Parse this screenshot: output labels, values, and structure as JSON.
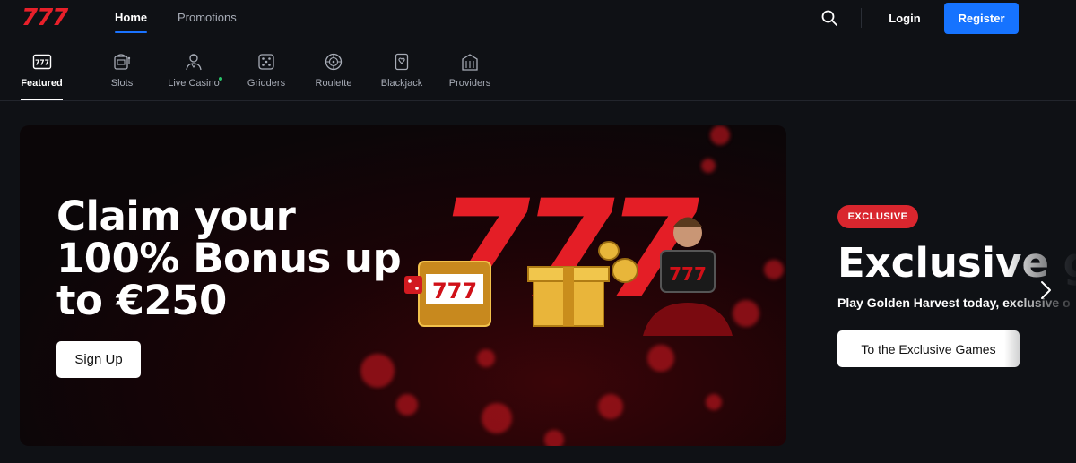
{
  "header": {
    "logo": "777",
    "nav": [
      {
        "label": "Home"
      },
      {
        "label": "Promotions"
      }
    ],
    "login_label": "Login",
    "register_label": "Register"
  },
  "categories": [
    {
      "label": "Featured",
      "icon": "777-badge-icon",
      "active": true
    },
    {
      "label": "Slots",
      "icon": "slot-machine-icon"
    },
    {
      "label": "Live Casino",
      "icon": "dealer-icon"
    },
    {
      "label": "Gridders",
      "icon": "dice-grid-icon"
    },
    {
      "label": "Roulette",
      "icon": "roulette-icon"
    },
    {
      "label": "Blackjack",
      "icon": "card-icon"
    },
    {
      "label": "Providers",
      "icon": "building-icon"
    }
  ],
  "hero": {
    "title": "Claim your 100% Bonus up to €250",
    "cta": "Sign Up",
    "art_text": "777"
  },
  "slide2": {
    "badge": "EXCLUSIVE",
    "title_visible": "Exclusive ",
    "title_faded": "ga",
    "subtitle": "Play Golden Harvest today, exclusive o",
    "cta": "To the Exclusive Games"
  },
  "colors": {
    "brand_red": "#e8202a",
    "register_blue": "#1673ff",
    "background": "#0f1115"
  }
}
